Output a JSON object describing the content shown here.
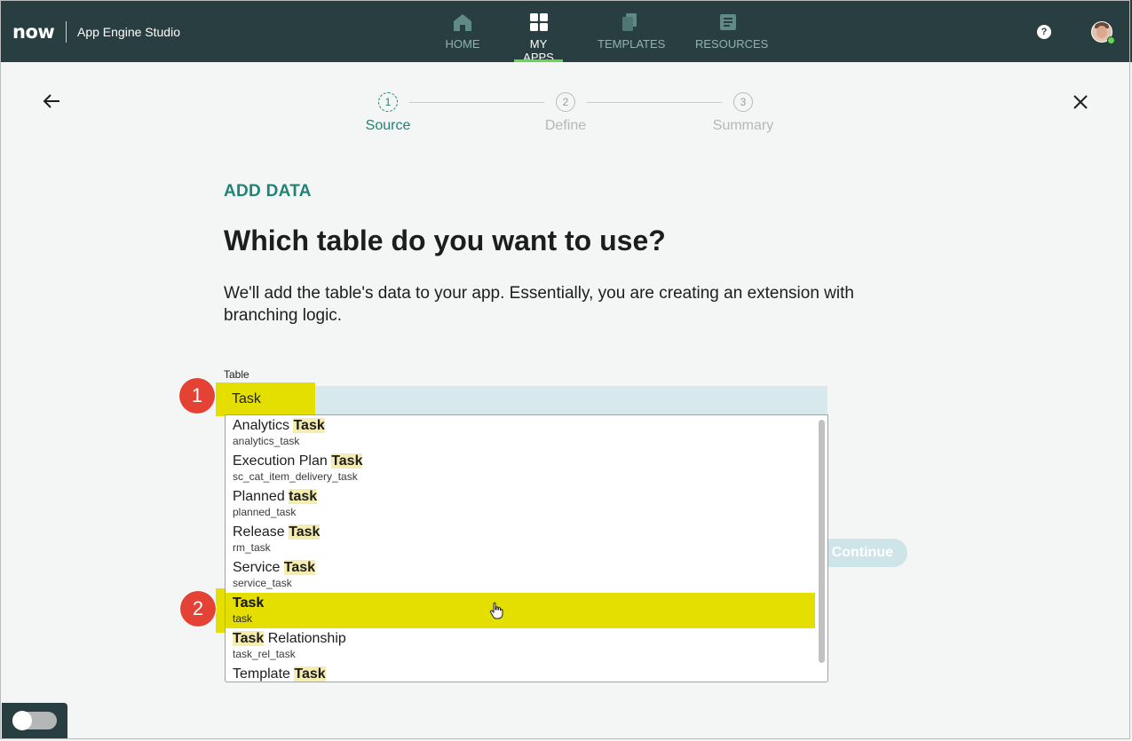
{
  "brand": {
    "logo": "now",
    "app_title": "App Engine Studio"
  },
  "nav": {
    "items": [
      {
        "label": "HOME",
        "icon": "home-icon",
        "active": false
      },
      {
        "label": "MY APPS",
        "icon": "grid-icon",
        "active": true
      },
      {
        "label": "TEMPLATES",
        "icon": "templates-icon",
        "active": false
      },
      {
        "label": "RESOURCES",
        "icon": "resources-icon",
        "active": false
      }
    ],
    "help": "?"
  },
  "stepper": {
    "steps": [
      {
        "num": "1",
        "label": "Source",
        "active": true
      },
      {
        "num": "2",
        "label": "Define",
        "active": false
      },
      {
        "num": "3",
        "label": "Summary",
        "active": false
      }
    ]
  },
  "content": {
    "eyebrow": "ADD DATA",
    "heading": "Which table do you want to use?",
    "description": "We'll add the table's data to your app. Essentially, you are creating an extension with branching logic.",
    "field_label": "Table",
    "input_value": "Task",
    "continue_label": "Continue"
  },
  "dropdown": {
    "options": [
      {
        "pre": "Analytics ",
        "match": "Task",
        "post": "",
        "sub": "analytics_task"
      },
      {
        "pre": "Execution Plan ",
        "match": "Task",
        "post": "",
        "sub": "sc_cat_item_delivery_task"
      },
      {
        "pre": "Planned ",
        "match": "task",
        "post": "",
        "sub": "planned_task"
      },
      {
        "pre": "Release ",
        "match": "Task",
        "post": "",
        "sub": "rm_task"
      },
      {
        "pre": "Service ",
        "match": "Task",
        "post": "",
        "sub": "service_task"
      },
      {
        "pre": "",
        "match": "Task",
        "post": "",
        "sub": "task"
      },
      {
        "pre": "",
        "match": "Task",
        "post": " Relationship",
        "sub": "task_rel_task"
      },
      {
        "pre": "Template ",
        "match": "Task",
        "post": "",
        "sub": ""
      }
    ],
    "selected_index": 5
  },
  "annotations": {
    "badge1": "1",
    "badge2": "2"
  },
  "colors": {
    "topbar": "#293e40",
    "accent": "#1f8476",
    "highlight": "#e5df00",
    "badge": "#e34234"
  }
}
